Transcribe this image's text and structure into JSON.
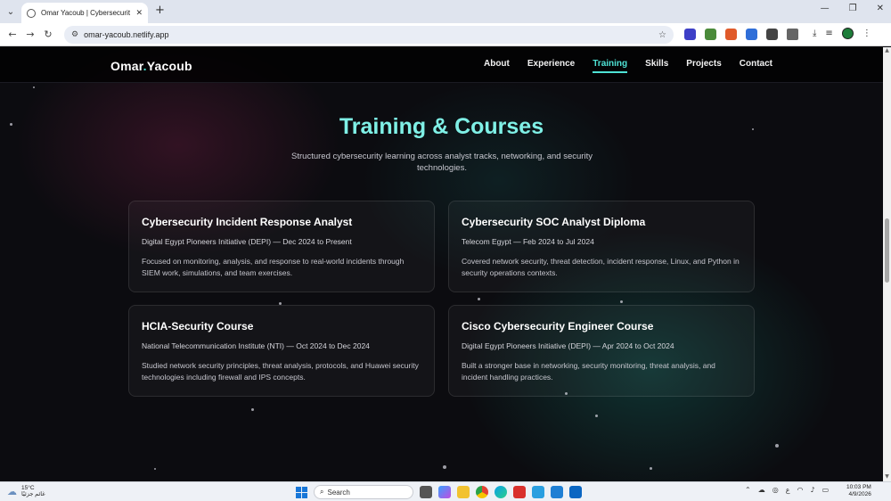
{
  "browser": {
    "tab_title": "Omar Yacoub | Cybersecurity Po",
    "url": "omar-yacoub.netlify.app"
  },
  "site": {
    "logo_first": "Omar",
    "logo_dot": ".",
    "logo_last": "Yacoub",
    "nav": [
      "About",
      "Experience",
      "Training",
      "Skills",
      "Projects",
      "Contact"
    ],
    "active_nav": "Training"
  },
  "section": {
    "title": "Training & Courses",
    "subtitle": "Structured cybersecurity learning across analyst tracks, networking, and security technologies."
  },
  "cards": [
    {
      "title": "Cybersecurity Incident Response Analyst",
      "org": "Digital Egypt Pioneers Initiative (DEPI) — Dec 2024 to Present",
      "desc": "Focused on monitoring, analysis, and response to real-world incidents through SIEM work, simulations, and team exercises."
    },
    {
      "title": "Cybersecurity SOC Analyst Diploma",
      "org": "Telecom Egypt — Feb 2024 to Jul 2024",
      "desc": "Covered network security, threat detection, incident response, Linux, and Python in security operations contexts."
    },
    {
      "title": "HCIA-Security Course",
      "org": "National Telecommunication Institute (NTI) — Oct 2024 to Dec 2024",
      "desc": "Studied network security principles, threat analysis, protocols, and Huawei security technologies including firewall and IPS concepts."
    },
    {
      "title": "Cisco Cybersecurity Engineer Course",
      "org": "Digital Egypt Pioneers Initiative (DEPI) — Apr 2024 to Oct 2024",
      "desc": "Built a stronger base in networking, security monitoring, threat analysis, and incident handling practices."
    }
  ],
  "taskbar": {
    "temp": "15°C",
    "weather_text": "غائم جزئيًا",
    "search_label": "Search",
    "time": "10:03 PM",
    "date": "4/9/2026",
    "lang": "ع"
  },
  "colors": {
    "accent": "#4fe3d6",
    "title": "#7ff0e6",
    "page_bg": "#0c0c10"
  }
}
